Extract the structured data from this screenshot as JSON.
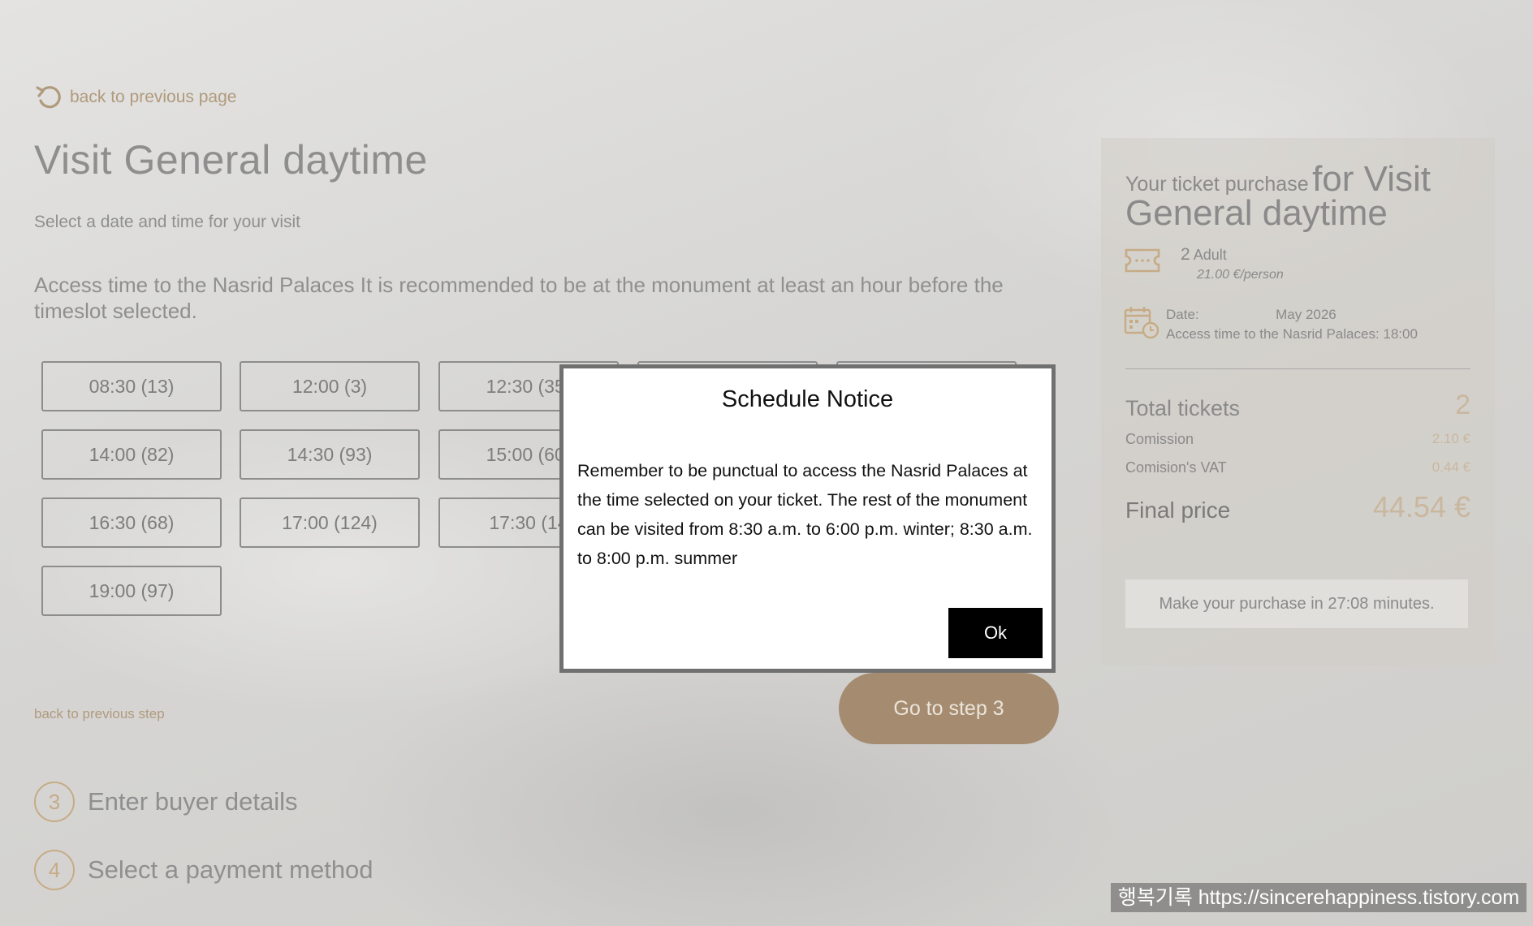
{
  "nav": {
    "back_page": "back to previous page"
  },
  "heading": {
    "title": "Visit General daytime",
    "subtitle": "Select a date and time for your visit",
    "access_note": "Access time to the Nasrid Palaces It is recommended to be at the monument at least an hour before the timeslot selected."
  },
  "slots": [
    {
      "label": "08:30 (13)"
    },
    {
      "label": "12:00 (3)"
    },
    {
      "label": "12:30 (35)"
    },
    {
      "label": ""
    },
    {
      "label": ""
    },
    {
      "label": "14:00 (82)"
    },
    {
      "label": "14:30 (93)"
    },
    {
      "label": "15:00 (60)"
    },
    {
      "label": "16:30 (68)"
    },
    {
      "label": "17:00 (124)"
    },
    {
      "label": "17:30 (14"
    },
    {
      "label": "19:00 (97)"
    }
  ],
  "actions": {
    "back_step": "back to previous step",
    "next_step": "Go to step 3"
  },
  "steps": [
    {
      "number": "3",
      "label": "Enter buyer details"
    },
    {
      "number": "4",
      "label": "Select a payment method"
    }
  ],
  "summary": {
    "title_small": "Your ticket purchase",
    "title_big": "for Visit General daytime",
    "ticket_count": "2",
    "ticket_type": "Adult",
    "price_per_person": "21.00 €/person",
    "date_label": "Date:",
    "date_value": "May 2026",
    "access_time": "Access time to the Nasrid Palaces: 18:00",
    "total_tickets_label": "Total tickets",
    "total_tickets_value": "2",
    "commission_label": "Comission",
    "commission_value": "2.10 €",
    "vat_label": "Comision's VAT",
    "vat_value": "0.44 €",
    "final_price_label": "Final price",
    "final_price_value": "44.54 €",
    "countdown": "Make your purchase in 27:08 minutes."
  },
  "modal": {
    "title": "Schedule Notice",
    "body": "Remember to be punctual to access the Nasrid Palaces at the time selected on your ticket. The rest of the monument can be visited from 8:30 a.m. to 6:00 p.m. winter; 8:30 a.m. to 8:00 p.m. summer",
    "ok_label": "Ok"
  },
  "watermark": "행복기록 https://sincerehappiness.tistory.com",
  "colors": {
    "accent": "#a58c71",
    "link": "#b09a7d",
    "modal_button": "#000000"
  },
  "icons": {
    "back": "undo-arrow-icon",
    "ticket": "ticket-icon",
    "calendar": "calendar-clock-icon"
  }
}
